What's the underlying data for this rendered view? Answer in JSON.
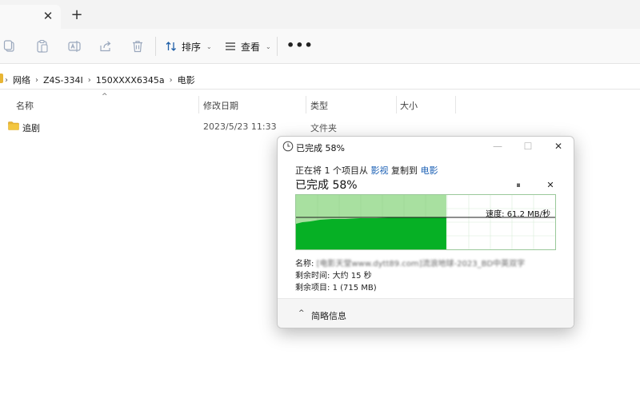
{
  "tabs": {
    "close": "✕",
    "new": "+"
  },
  "toolbar": {
    "sort_label": "排序",
    "view_label": "查看",
    "more_label": "•••",
    "caret": "⌄"
  },
  "breadcrumb": {
    "items": [
      "网络",
      "Z4S-334I",
      "150XXXX6345a",
      "电影"
    ],
    "separator": "›"
  },
  "columns": {
    "name": "名称",
    "modified": "修改日期",
    "type": "类型",
    "size": "大小",
    "sort_indicator": "^"
  },
  "files": [
    {
      "name": "追剧",
      "modified": "2023/5/23 11:33",
      "type": "文件夹",
      "size": ""
    }
  ],
  "dialog": {
    "title": "已完成 58%",
    "win_min": "—",
    "win_max": "☐",
    "win_close": "✕",
    "line_prefix": "正在将 1 个项目从",
    "source": "影视",
    "line_mid": "复制到",
    "dest": "电影",
    "percent_text": "已完成 58%",
    "progress": 0.58,
    "pause_glyph": "⏸",
    "cancel_glyph": "✕",
    "speed_text": "速度: 61.2 MB/秒",
    "name_label": "名称:",
    "name_value": "[电影天堂www.dytt89.com]流浪地球-2023_BD中英双字",
    "time_label": "剩余时间:",
    "time_value": "大约 15 秒",
    "items_label": "剩余项目:",
    "items_value": "1 (715 MB)",
    "details_chevron": "^",
    "details_label": "简略信息"
  },
  "colors": {
    "progress_fill": "#06b025",
    "progress_bg": "#a8e0a0",
    "link": "#1a5fb4",
    "folder": "#e8b534"
  }
}
